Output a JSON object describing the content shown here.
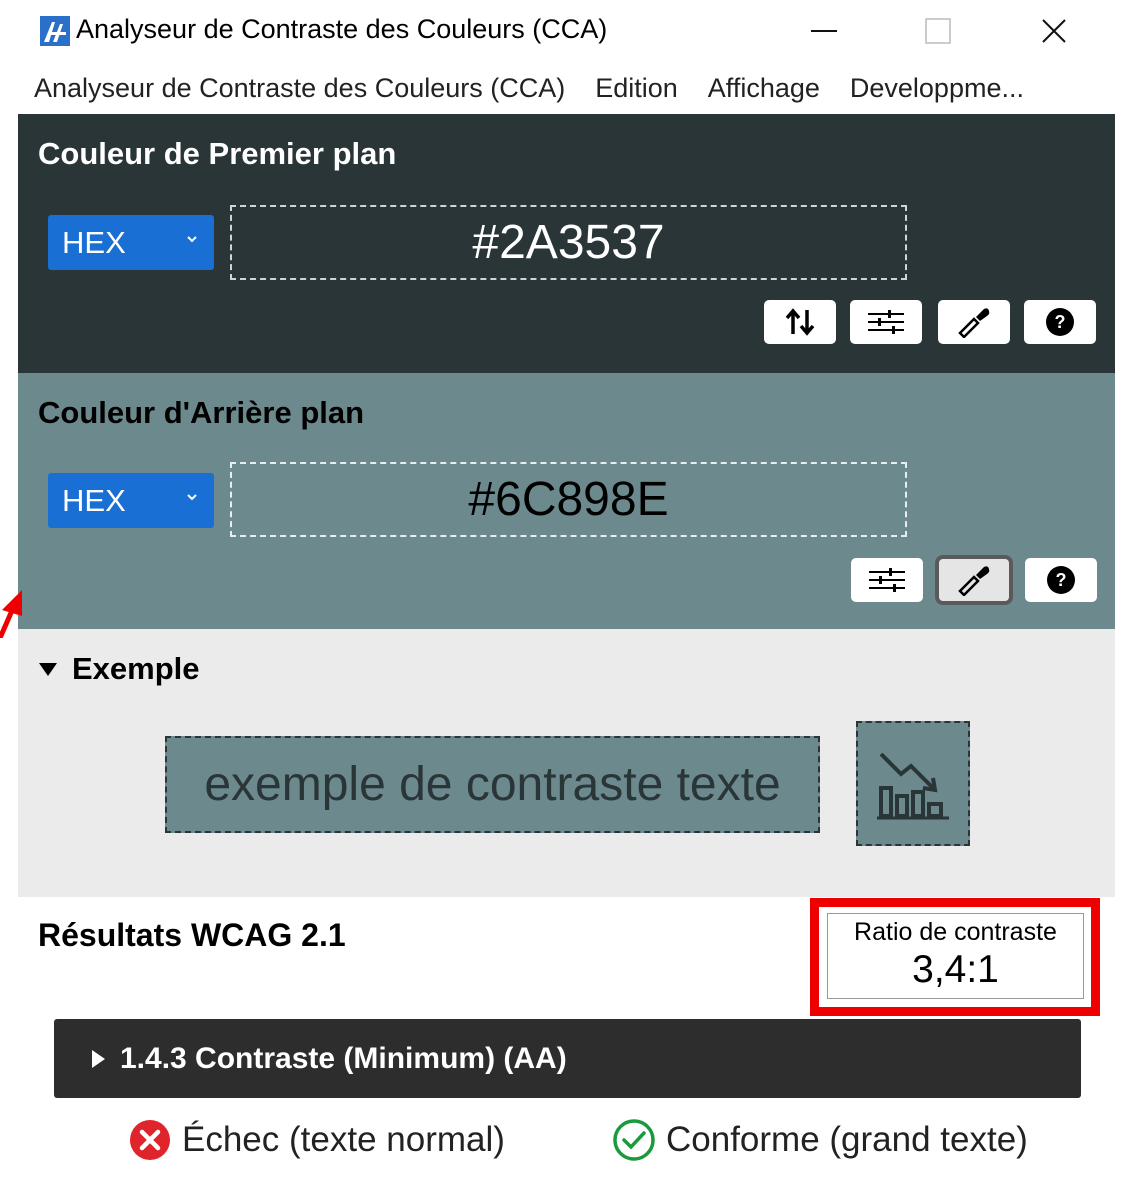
{
  "window": {
    "title": "Analyseur de Contraste des Couleurs (CCA)",
    "icon": "cca-app-icon",
    "minimize_icon": "minimize-icon",
    "maximize_icon": "maximize-icon",
    "close_icon": "close-icon"
  },
  "menu": {
    "items": [
      {
        "label": "Analyseur de Contraste des Couleurs (CCA)"
      },
      {
        "label": "Edition"
      },
      {
        "label": "Affichage"
      },
      {
        "label": "Developpme..."
      }
    ]
  },
  "foreground": {
    "title": "Couleur de Premier plan",
    "format": "HEX",
    "value": "#2A3537",
    "color": "#2A3537",
    "tools": [
      "swap-icon",
      "sliders-icon",
      "eyedropper-icon",
      "help-icon"
    ]
  },
  "background": {
    "title": "Couleur d'Arrière plan",
    "format": "HEX",
    "value": "#6C898E",
    "color": "#6C898E",
    "tools": [
      "sliders-icon",
      "eyedropper-icon",
      "help-icon"
    ]
  },
  "example": {
    "header": "Exemple",
    "sample_text": "exemple de contraste texte",
    "icon": "chart-decrease-icon"
  },
  "results": {
    "title": "Résultats WCAG 2.1",
    "ratio_label": "Ratio de contraste",
    "ratio_value": "3,4:1",
    "criterion": "1.4.3 Contraste (Minimum) (AA)",
    "fail_text": "Échec (texte normal)",
    "pass_text": "Conforme (grand texte)",
    "fail_color": "#e0242c",
    "pass_color": "#1a9a3c"
  },
  "annotation_color": "#ee0000"
}
